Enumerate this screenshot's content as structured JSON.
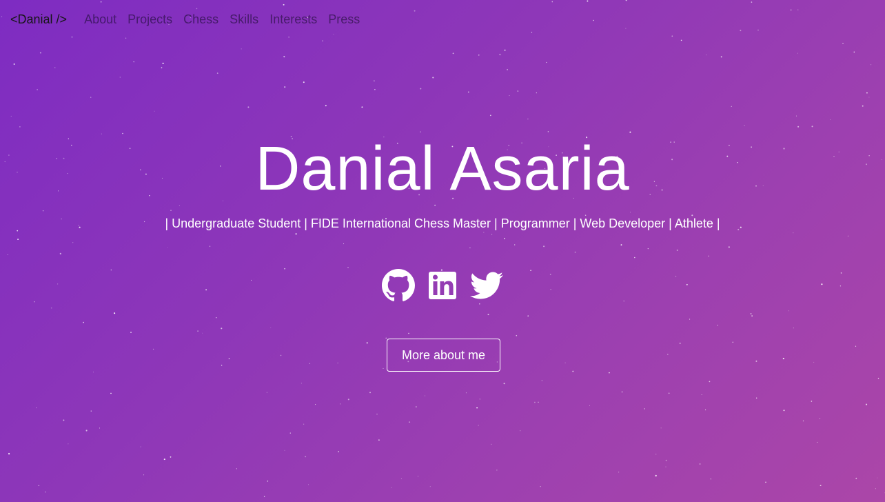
{
  "nav": {
    "brand": "<Danial />",
    "links": [
      "About",
      "Projects",
      "Chess",
      "Skills",
      "Interests",
      "Press"
    ]
  },
  "hero": {
    "name": "Danial Asaria",
    "tagline": "| Undergraduate Student | FIDE International Chess Master | Programmer | Web Developer | Athlete |",
    "cta_label": "More about me"
  },
  "social": {
    "icons": [
      "github-icon",
      "linkedin-icon",
      "twitter-icon"
    ]
  },
  "colors": {
    "gradient_start": "#7e2cc2",
    "gradient_end": "#ab46a8",
    "text": "#ffffff",
    "brand_text": "#161616"
  }
}
